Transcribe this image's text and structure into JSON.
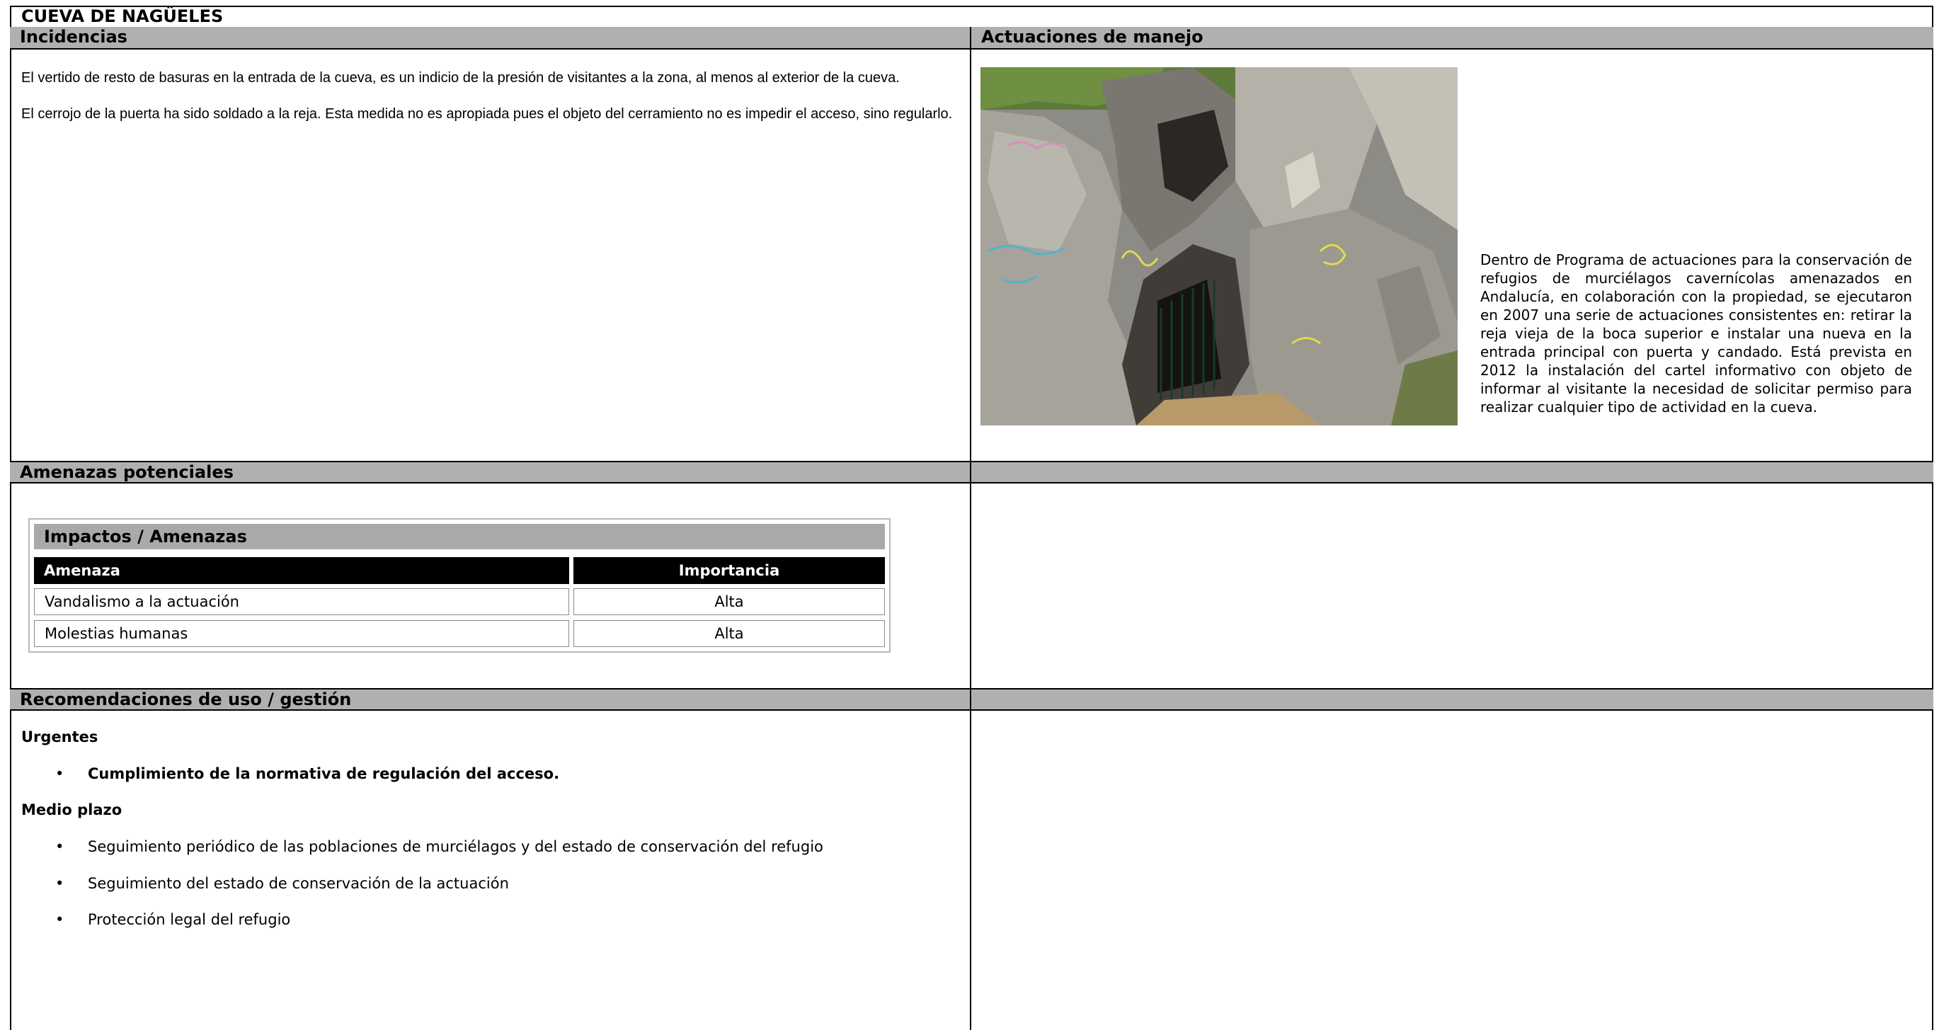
{
  "doc_title": "CUEVA DE NAGÜELES",
  "incidencias": {
    "heading": "Incidencias",
    "p1": "El vertido de resto de basuras en la entrada de la cueva, es un indicio de la presión de visitantes a la zona, al menos al exterior de la cueva.",
    "p2": "El cerrojo de la puerta ha sido soldado a la reja. Esta medida no es apropiada pues el objeto del cerramiento no es impedir el acceso, sino regularlo."
  },
  "actuaciones": {
    "heading": "Actuaciones de manejo",
    "photo_icon": "cave-entrance-photo",
    "description": "Dentro de Programa de actuaciones para la conservación de refugios de murciélagos cavernícolas amenazados en Andalucía, en colaboración con la propiedad, se ejecutaron en 2007 una serie de actuaciones consistentes en: retirar la reja vieja de la boca superior e instalar una nueva en la entrada principal con puerta y candado. Está prevista en 2012 la instalación del cartel informativo con objeto de informar al visitante la necesidad de solicitar permiso para realizar cualquier tipo de actividad en la cueva."
  },
  "amenazas": {
    "heading": "Amenazas potenciales",
    "table_title": "Impactos / Amenazas",
    "col_amenaza": "Amenaza",
    "col_importancia": "Importancia",
    "rows": [
      {
        "amenaza": "Vandalismo a la actuación",
        "importancia": "Alta"
      },
      {
        "amenaza": "Molestias humanas",
        "importancia": "Alta"
      }
    ]
  },
  "recomendaciones": {
    "heading": "Recomendaciones de uso / gestión",
    "urgentes_label": "Urgentes",
    "urgentes": [
      "Cumplimiento de la normativa de regulación del acceso."
    ],
    "medio_label": "Medio plazo",
    "medio": [
      "Seguimiento periódico de las poblaciones de murciélagos y del estado de conservación del refugio",
      "Seguimiento del estado de conservación de la actuación",
      "Protección legal del refugio"
    ]
  },
  "colors": {
    "header_bg": "#b0b0b0",
    "table_header_bg": "#000000"
  }
}
